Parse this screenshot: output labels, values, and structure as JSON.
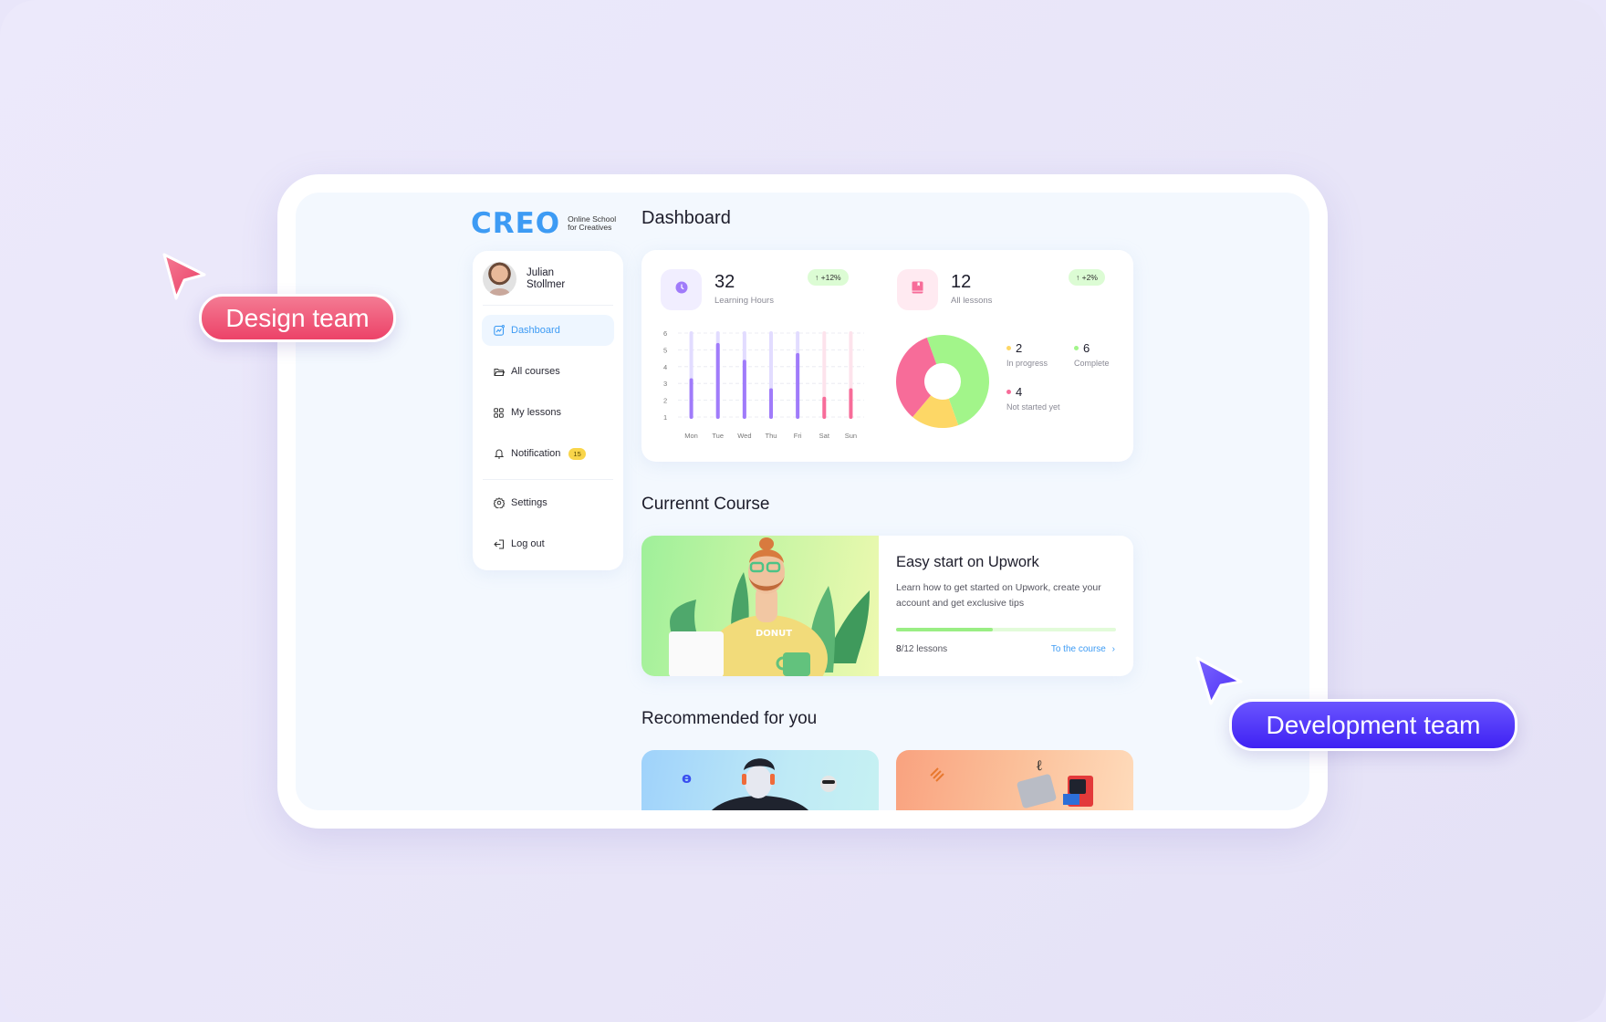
{
  "app": {
    "logo_text": "CREO",
    "logo_subtitle_line1": "Online School",
    "logo_subtitle_line2": "for Creatives",
    "page_title": "Dashboard"
  },
  "user": {
    "first_name": "Julian",
    "last_name": "Stollmer"
  },
  "sidebar": {
    "items": [
      {
        "label": "Dashboard",
        "icon": "chart-icon",
        "active": true
      },
      {
        "label": "All courses",
        "icon": "folder-icon"
      },
      {
        "label": "My lessons",
        "icon": "grid-icon"
      },
      {
        "label": "Notification",
        "icon": "bell-icon",
        "badge": "15"
      }
    ],
    "bottom_items": [
      {
        "label": "Settings",
        "icon": "gear-icon"
      },
      {
        "label": "Log out",
        "icon": "logout-icon"
      }
    ]
  },
  "stats": {
    "learning_hours": {
      "value": "32",
      "label": "Learning Hours",
      "trend": "+12%",
      "icon": "clock-icon"
    },
    "all_lessons": {
      "value": "12",
      "label": "All lessons",
      "trend": "+2%",
      "icon": "book-icon"
    }
  },
  "chart_data": [
    {
      "type": "bar",
      "title": "Learning Hours",
      "categories": [
        "Mon",
        "Tue",
        "Wed",
        "Thu",
        "Fri",
        "Sat",
        "Sun"
      ],
      "values": [
        3.2,
        5.3,
        4.3,
        2.6,
        4.7,
        2.1,
        2.6
      ],
      "ylim": [
        1,
        6
      ],
      "yticks": [
        1,
        2,
        3,
        4,
        5,
        6
      ],
      "grid": true,
      "colors": {
        "weekday": "#a07bfa",
        "weekday_track": "#e2dcff",
        "weekend": "#f76c99",
        "weekend_track": "#fde3ec"
      }
    },
    {
      "type": "pie",
      "title": "All lessons",
      "donut": true,
      "slices": [
        {
          "label": "Complete",
          "value": 6,
          "color": "#a2f58a"
        },
        {
          "label": "In progress",
          "value": 2,
          "color": "#fdd766"
        },
        {
          "label": "Not started yet",
          "value": 4,
          "color": "#f76c99"
        }
      ],
      "legend": "right"
    }
  ],
  "current_course": {
    "section_title": "Currennt Course",
    "title": "Easy start on Upwork",
    "description": "Learn how to get started on Upwork, create your account and get exclusive tips",
    "progress_fraction": 0.44,
    "lessons_done": "8",
    "lessons_total": "/12 lessons",
    "link_label": "To the course",
    "link_icon": "chevron-right-icon"
  },
  "recommended": {
    "section_title": "Recommended for you",
    "cards": [
      {
        "name": "recommended-course-1"
      },
      {
        "name": "recommended-course-2"
      }
    ]
  },
  "annotations": {
    "design_team": {
      "label": "Design team",
      "color": "#f0506e"
    },
    "development_team": {
      "label": "Development team",
      "color": "#5133f5"
    }
  }
}
